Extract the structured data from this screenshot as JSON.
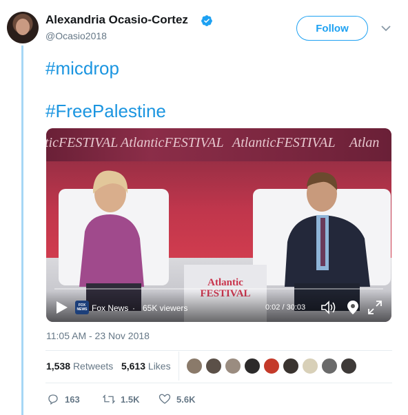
{
  "author": {
    "name": "Alexandria Ocasio-Cortez",
    "handle": "@Ocasio2018",
    "follow_label": "Follow"
  },
  "tweet": {
    "hashtags": [
      "#micdrop",
      "#FreePalestine"
    ],
    "timestamp": "11:05 AM - 23 Nov 2018"
  },
  "video": {
    "banner": [
      "ticFESTIVAL",
      "AtlanticFESTIVAL",
      "AtlanticFESTIVAL",
      "Atlan"
    ],
    "table_sign": "Atlantic FESTIVAL",
    "source": "Fox News",
    "separator": "·",
    "viewers": "65K viewers",
    "time": "0:02 / 30:03",
    "source_logo_text": "FOX NEWS"
  },
  "stats": {
    "retweets_count": "1,538",
    "retweets_label": "Retweets",
    "likes_count": "5,613",
    "likes_label": "Likes"
  },
  "likers": {
    "colors": [
      "#8a7a6a",
      "#5b5048",
      "#9a8c80",
      "#2c2a2a",
      "#c43a2a",
      "#3a3430",
      "#d8d0b8",
      "#6a6a6a",
      "#3e3a38"
    ]
  },
  "actions": {
    "replies": "163",
    "retweets": "1.5K",
    "likes": "5.6K"
  },
  "colors": {
    "accent": "#1da1f2",
    "hashtag": "#1b95e0",
    "muted": "#657786",
    "thread_line": "#a6d7f5"
  }
}
